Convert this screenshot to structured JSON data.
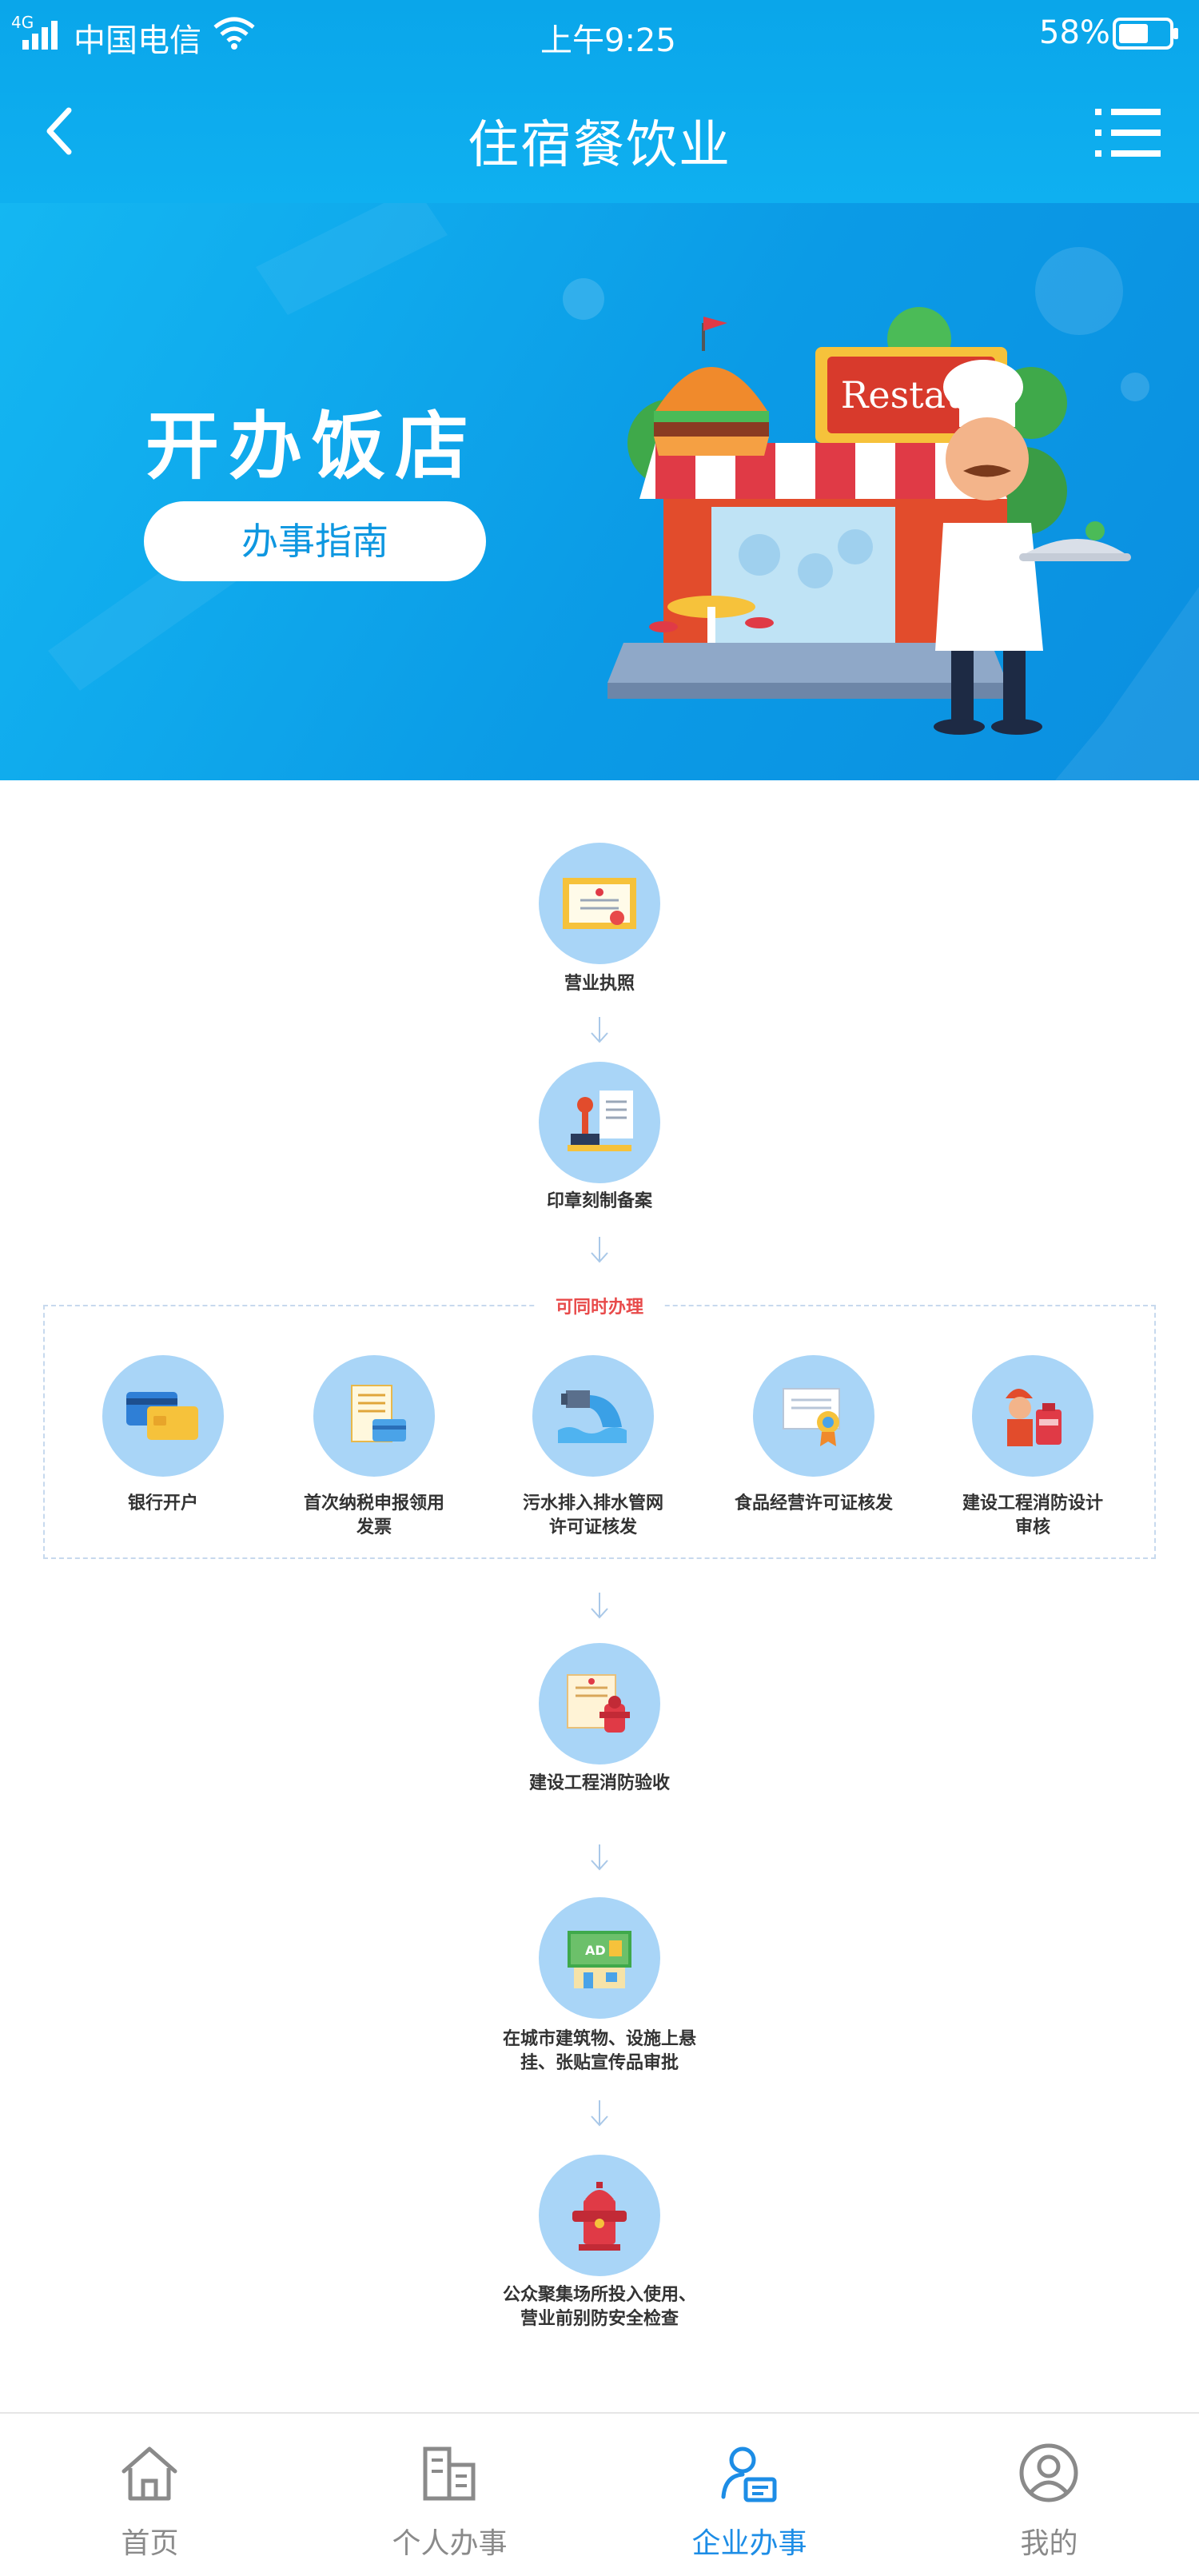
{
  "status_bar": {
    "network": "4G",
    "carrier": "中国电信",
    "time": "上午9:25",
    "battery": "58%"
  },
  "nav": {
    "title": "住宿餐饮业"
  },
  "banner": {
    "title": "开办饭店",
    "button_label": "办事指南",
    "illustration_text": "Restau-"
  },
  "flow": {
    "step1": {
      "label": "营业执照",
      "icon": "certificate-icon"
    },
    "step2": {
      "label": "印章刻制备案",
      "icon": "stamp-icon"
    },
    "group_label": "可同时办理",
    "parallel": [
      {
        "label_line1": "银行开户",
        "label_line2": "",
        "icon": "bank-card-icon"
      },
      {
        "label_line1": "首次纳税申报领用",
        "label_line2": "发票",
        "icon": "invoice-icon"
      },
      {
        "label_line1": "污水排入排水管网",
        "label_line2": "许可证核发",
        "icon": "sewage-pipe-icon"
      },
      {
        "label_line1": "食品经营许可证核发",
        "label_line2": "",
        "icon": "food-license-icon"
      },
      {
        "label_line1": "建设工程消防设计",
        "label_line2": "审核",
        "icon": "fire-design-icon"
      }
    ],
    "step3": {
      "label": "建设工程消防验收",
      "icon": "fire-acceptance-icon"
    },
    "step4": {
      "label_line1": "在城市建筑物、设施上悬",
      "label_line2": "挂、张贴宣传品审批",
      "icon": "billboard-icon",
      "badge": "AD"
    },
    "step5": {
      "label_line1": "公众聚集场所投入使用、",
      "label_line2": "营业前别防安全检查",
      "icon": "fire-hydrant-icon"
    }
  },
  "tabbar": {
    "items": [
      {
        "label": "首页",
        "icon": "home-icon",
        "active": false
      },
      {
        "label": "个人办事",
        "icon": "building-icon",
        "active": false
      },
      {
        "label": "企业办事",
        "icon": "enterprise-icon",
        "active": true
      },
      {
        "label": "我的",
        "icon": "user-icon",
        "active": false
      }
    ]
  },
  "colors": {
    "primary": "#0ea8ec",
    "accent": "#1d8de6",
    "circle": "#a9d5f7",
    "group_tag": "#e84a4a"
  }
}
